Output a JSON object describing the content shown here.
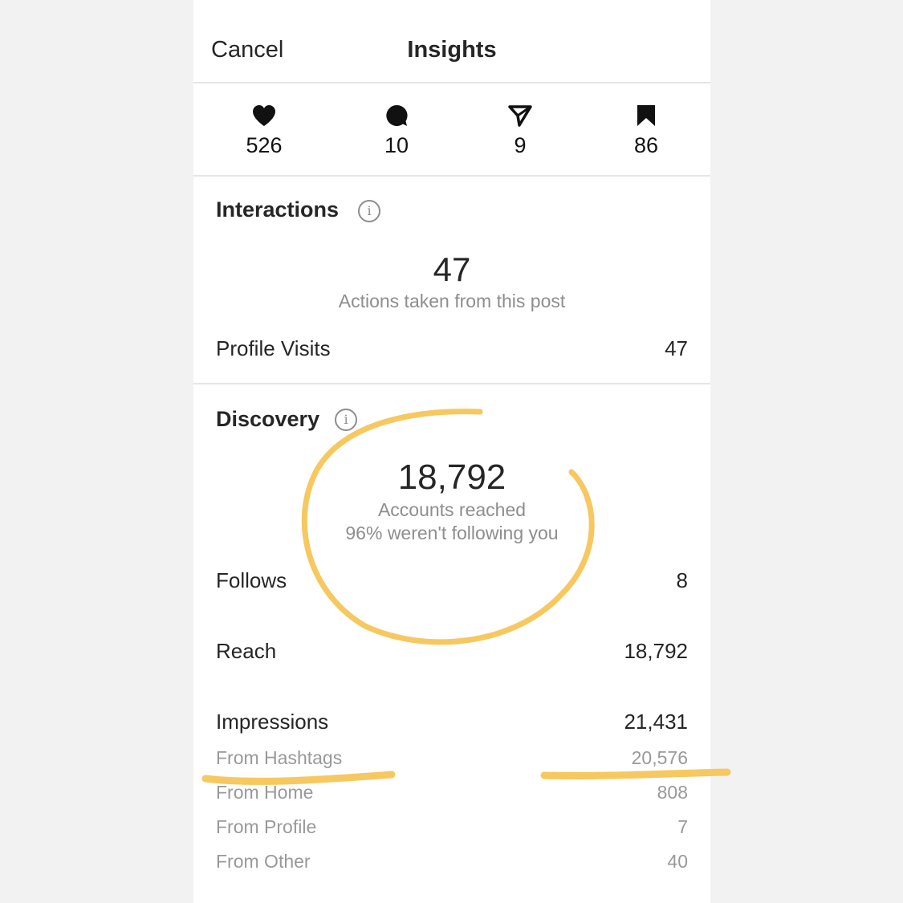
{
  "header": {
    "cancel_label": "Cancel",
    "title": "Insights"
  },
  "stats": [
    {
      "icon": "heart-icon",
      "value": "526"
    },
    {
      "icon": "comment-icon",
      "value": "10"
    },
    {
      "icon": "share-icon",
      "value": "9"
    },
    {
      "icon": "bookmark-icon",
      "value": "86"
    }
  ],
  "interactions": {
    "title": "Interactions",
    "total": "47",
    "caption": "Actions taken from this post",
    "rows": [
      {
        "label": "Profile Visits",
        "value": "47"
      }
    ]
  },
  "discovery": {
    "title": "Discovery",
    "total": "18,792",
    "caption": "Accounts reached",
    "caption2": "96% weren't following you",
    "rows": [
      {
        "label": "Follows",
        "value": "8"
      },
      {
        "label": "Reach",
        "value": "18,792"
      },
      {
        "label": "Impressions",
        "value": "21,431"
      }
    ],
    "sub_rows": [
      {
        "label": "From Hashtags",
        "value": "20,576"
      },
      {
        "label": "From Home",
        "value": "808"
      },
      {
        "label": "From Profile",
        "value": "7"
      },
      {
        "label": "From Other",
        "value": "40"
      }
    ]
  },
  "colors": {
    "annotation": "#f6c85f",
    "text": "#262626",
    "muted": "#8e8e8e"
  }
}
